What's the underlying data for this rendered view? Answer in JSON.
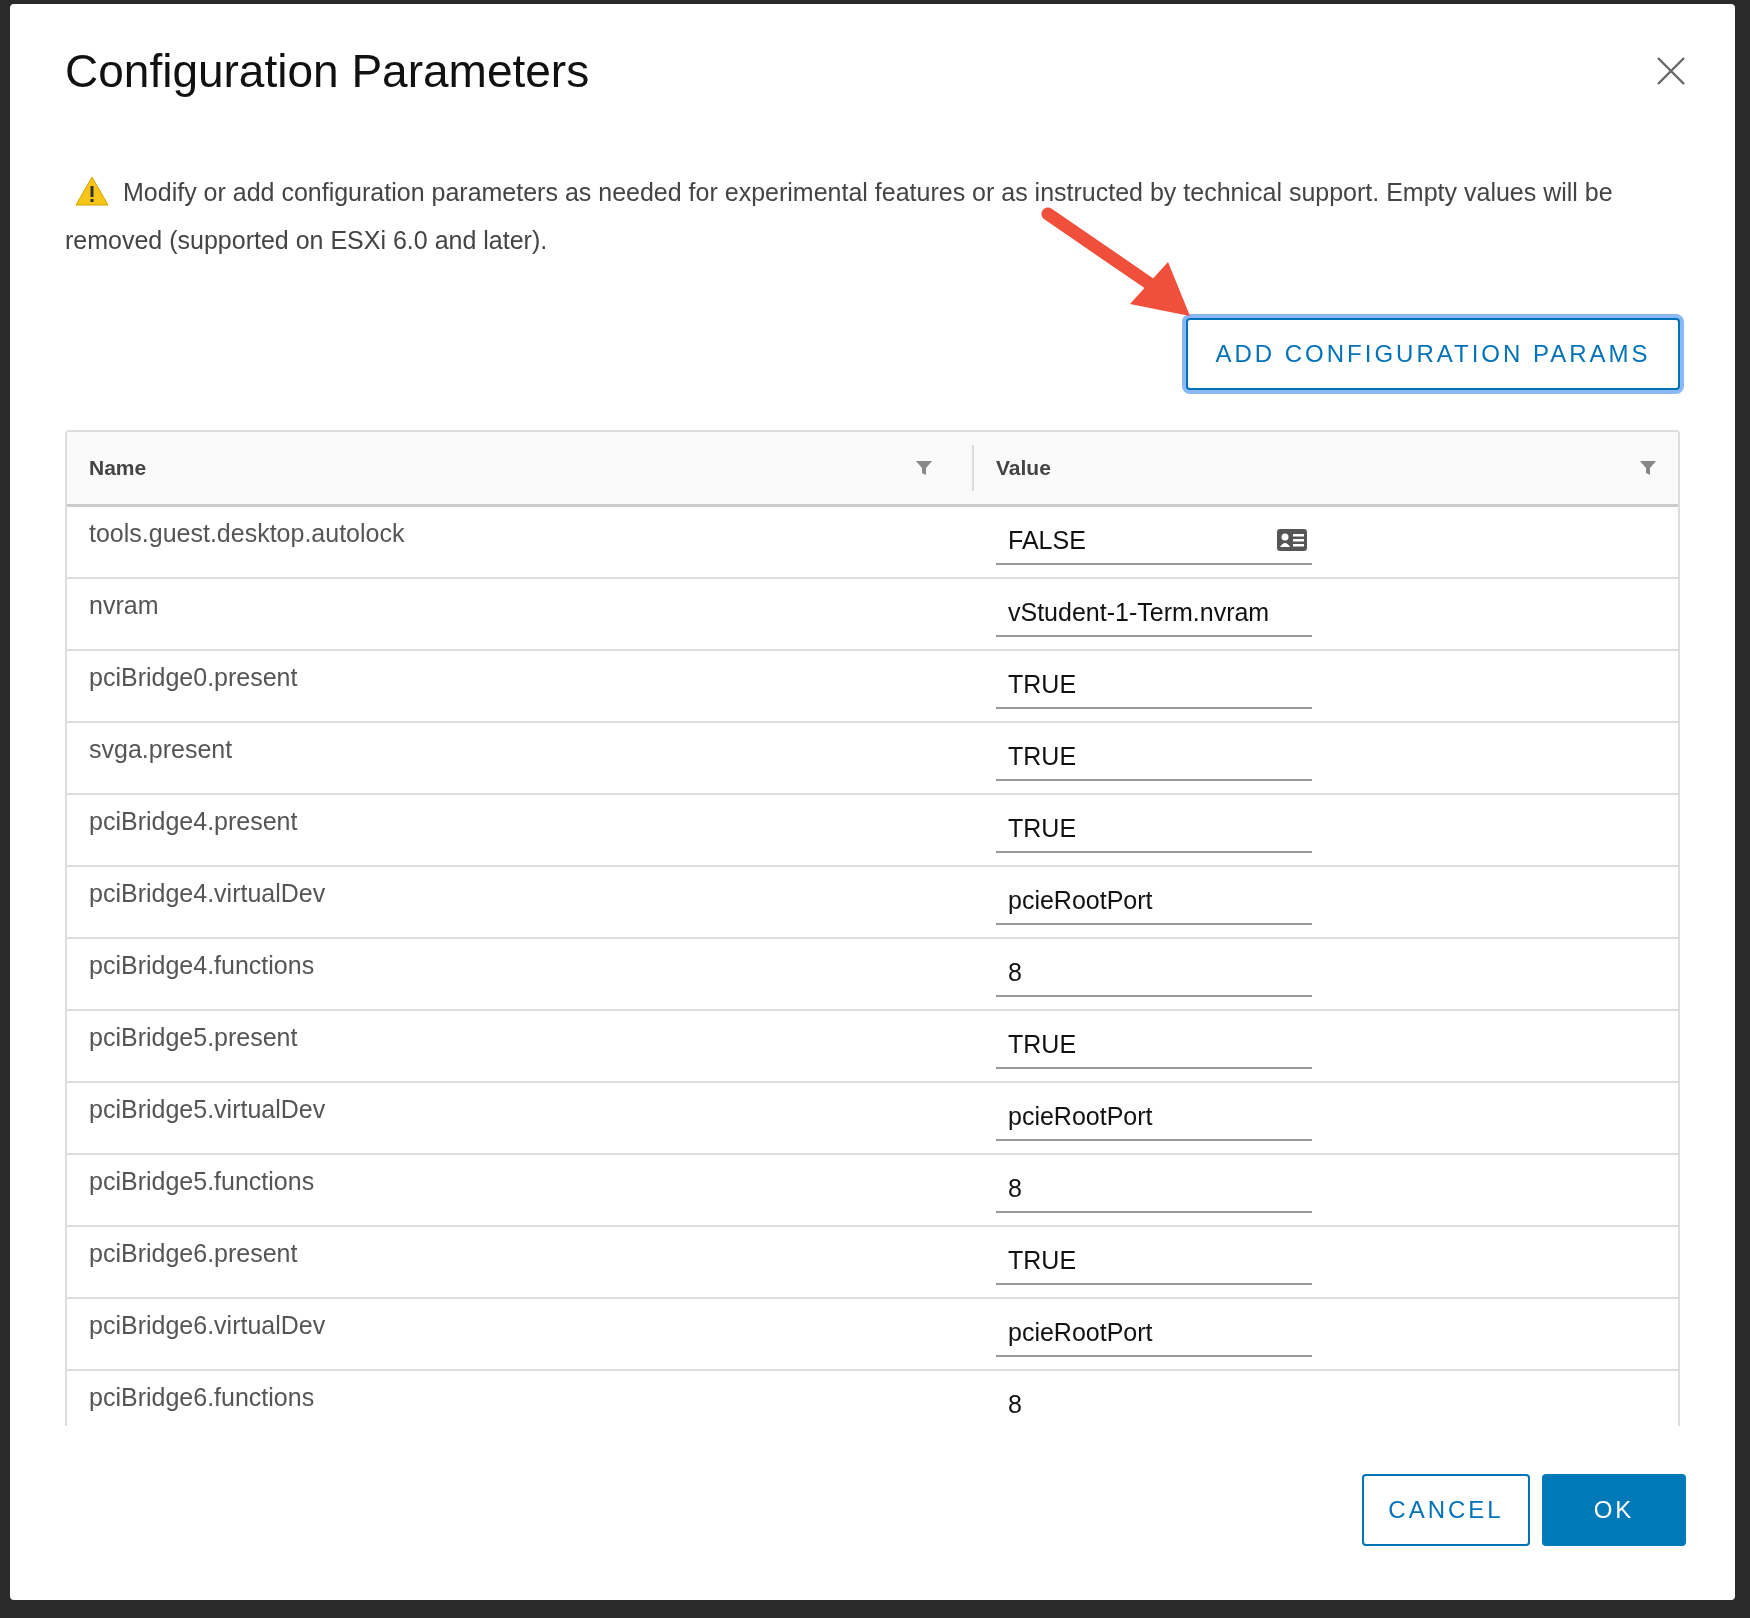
{
  "dialog": {
    "title": "Configuration Parameters",
    "notice": "Modify or add configuration parameters as needed for experimental features or as instructed by technical support. Empty values will be removed (supported on ESXi 6.0 and later).",
    "add_button": "ADD CONFIGURATION PARAMS",
    "table": {
      "columns": [
        {
          "label": "Name"
        },
        {
          "label": "Value"
        }
      ],
      "rows": [
        {
          "name": "tools.guest.desktop.autolock",
          "value": "FALSE",
          "kind": "picker"
        },
        {
          "name": "nvram",
          "value": "vStudent-1-Term.nvram",
          "kind": "text"
        },
        {
          "name": "pciBridge0.present",
          "value": "TRUE",
          "kind": "text"
        },
        {
          "name": "svga.present",
          "value": "TRUE",
          "kind": "text"
        },
        {
          "name": "pciBridge4.present",
          "value": "TRUE",
          "kind": "text"
        },
        {
          "name": "pciBridge4.virtualDev",
          "value": "pcieRootPort",
          "kind": "text"
        },
        {
          "name": "pciBridge4.functions",
          "value": "8",
          "kind": "text"
        },
        {
          "name": "pciBridge5.present",
          "value": "TRUE",
          "kind": "text"
        },
        {
          "name": "pciBridge5.virtualDev",
          "value": "pcieRootPort",
          "kind": "text"
        },
        {
          "name": "pciBridge5.functions",
          "value": "8",
          "kind": "text"
        },
        {
          "name": "pciBridge6.present",
          "value": "TRUE",
          "kind": "text"
        },
        {
          "name": "pciBridge6.virtualDev",
          "value": "pcieRootPort",
          "kind": "text"
        },
        {
          "name": "pciBridge6.functions",
          "value": "8",
          "kind": "text"
        }
      ]
    },
    "buttons": [
      {
        "label": "CANCEL",
        "kind": "secondary"
      },
      {
        "label": "OK",
        "kind": "primary"
      }
    ]
  }
}
